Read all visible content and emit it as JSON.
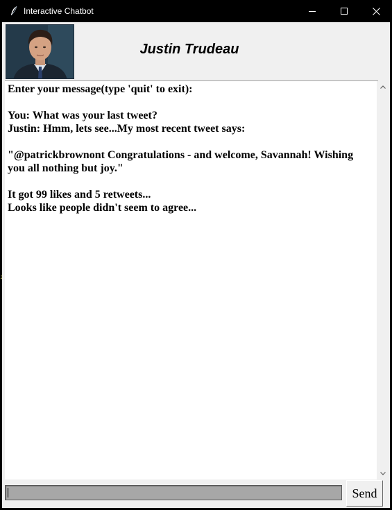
{
  "window": {
    "title": "Interactive Chatbot",
    "icon": "feather-icon",
    "controls": [
      "minimize-icon",
      "maximize-icon",
      "close-icon"
    ]
  },
  "header": {
    "name": "Justin Trudeau",
    "avatar": "profile-photo"
  },
  "chat": {
    "lines": [
      "Enter your message(type 'quit' to exit):",
      "",
      "You: What was your last tweet?",
      "Justin: Hmm, lets see...My most recent tweet says:",
      "",
      "\"@patrickbrownont Congratulations - and welcome, Savannah! Wishing",
      "you all nothing but joy.\"",
      "",
      "It got 99 likes and 5 retweets...",
      "Looks like people didn't seem to agree..."
    ]
  },
  "input": {
    "value": ""
  },
  "send_label": "Send",
  "colors": {
    "titlebar": "#000000",
    "window_bg": "#f0f0f0",
    "chat_bg": "#ffffff",
    "input_bg": "#a7a7a7"
  }
}
